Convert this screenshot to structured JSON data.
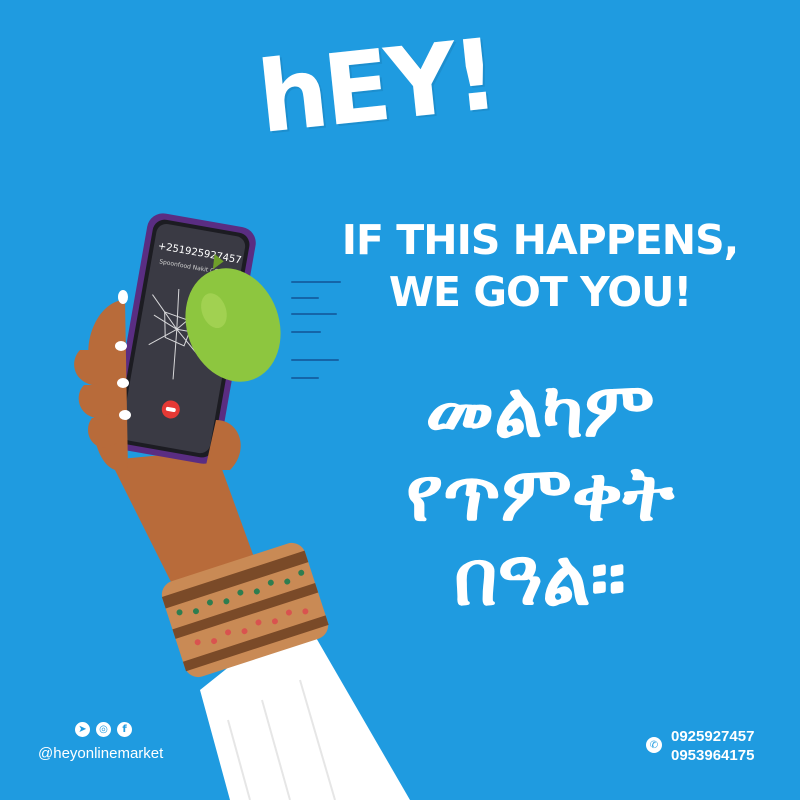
{
  "logo": {
    "text": "hEY!"
  },
  "headline": {
    "line1": "IF THIS HAPPENS,",
    "line2": "WE GOT YOU!"
  },
  "amharic": {
    "line1": "መልካም",
    "line2": "የጥምቀት",
    "line3": "በዓል።"
  },
  "phone_screen": {
    "number": "+251925927457",
    "caller": "Spoonfood Nakit CCC"
  },
  "footer": {
    "social_icons": [
      "telegram-icon",
      "instagram-icon",
      "facebook-icon"
    ],
    "handle": "@heyonlinemarket",
    "phones": [
      "0925927457",
      "0953964175"
    ]
  },
  "colors": {
    "background": "#1f9be0",
    "text": "#ffffff",
    "lime": "#8dc63f",
    "skin": "#b86b3a"
  }
}
